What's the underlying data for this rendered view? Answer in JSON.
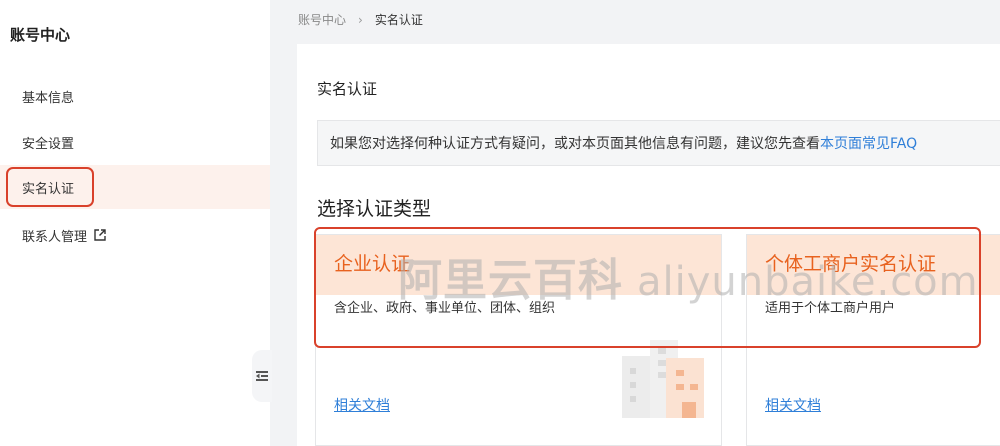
{
  "sidebar": {
    "title": "账号中心",
    "items": [
      {
        "label": "基本信息"
      },
      {
        "label": "安全设置"
      },
      {
        "label": "实名认证"
      },
      {
        "label": "联系人管理"
      }
    ]
  },
  "breadcrumb": {
    "parent": "账号中心",
    "separator": "›",
    "current": "实名认证"
  },
  "main": {
    "title": "实名认证",
    "notice_text": "如果您对选择何种认证方式有疑问，或对本页面其他信息有问题，建议您先查看",
    "notice_link": "本页面常见FAQ",
    "section_title": "选择认证类型",
    "cards": [
      {
        "title": "企业认证",
        "desc": "含企业、政府、事业单位、团体、组织",
        "link": "相关文档"
      },
      {
        "title": "个体工商户实名认证",
        "desc": "适用于个体工商户用户",
        "link": "相关文档"
      }
    ]
  },
  "watermark": {
    "cn": "阿里云百科",
    "en": "aliyunbaike.com"
  },
  "colors": {
    "accent": "#e8621f",
    "highlight_border": "#d9412b",
    "link": "#2f7fd8",
    "card_header_bg": "#fde5d6"
  }
}
